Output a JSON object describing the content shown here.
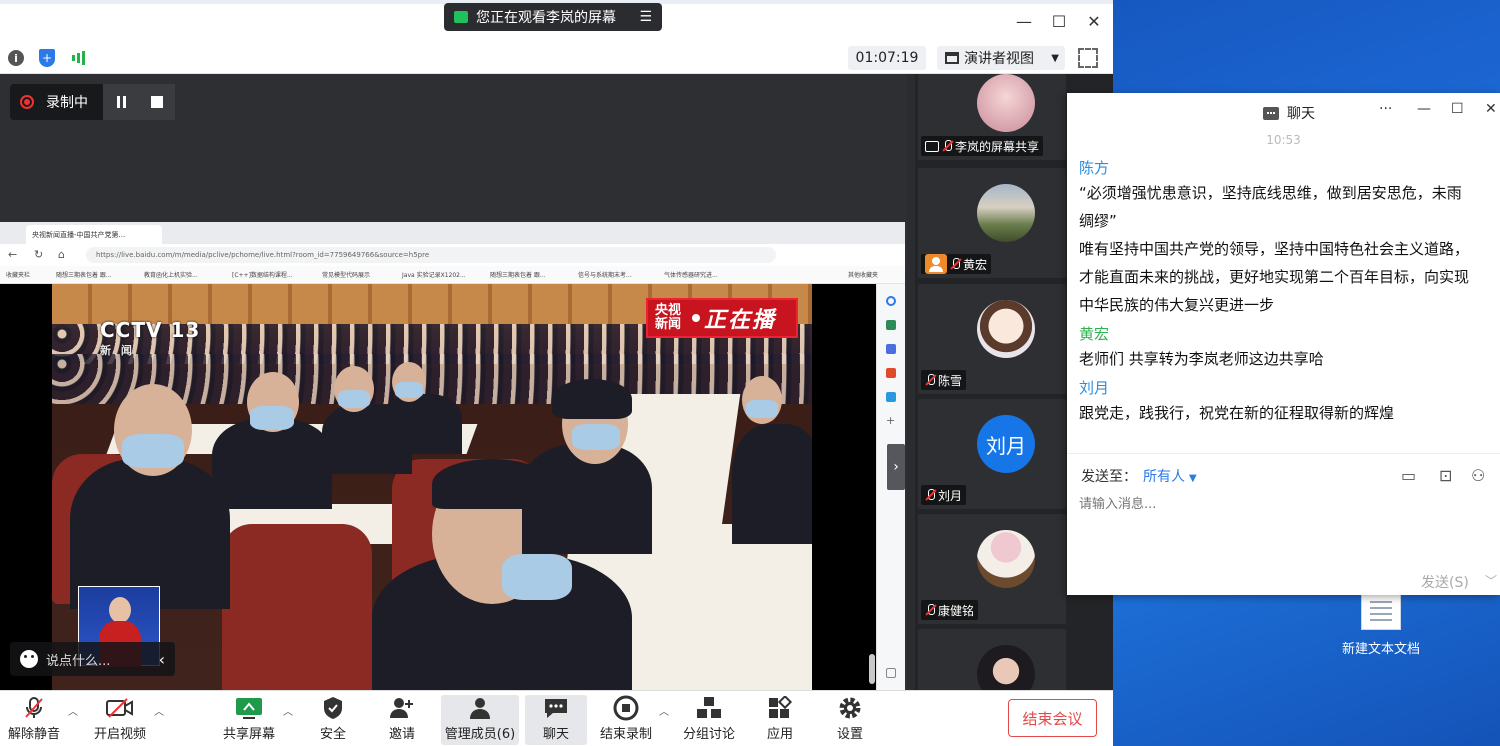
{
  "meeting": {
    "share_banner": "您正在观看李岚的屏幕",
    "timer": "01:07:19",
    "view_mode": "演讲者视图",
    "recording": {
      "label": "录制中"
    },
    "video_chat_placeholder": "说点什么..."
  },
  "browser": {
    "tab_title": "央视新闻直播-中国共产党第...",
    "url": "https://live.baidu.com/m/media/pclive/pchome/live.html?room_id=7759649766&source=h5pre",
    "favorites": [
      "收藏夹栏",
      "随想三期表包着 跟...",
      "教育函化上机实验...",
      "[C++]数据结构课程...",
      "常见模型代码展示",
      "Java 实验记录X1202...",
      "随想三期表包着 跟...",
      "信号与系统期末考...",
      "气体传感器研究进...",
      "其他收藏夹"
    ],
    "overlay": {
      "channel": "CCTV 13",
      "channel_sub": "新 闻",
      "live_left": "央视\n新闻",
      "live_right": "正在播"
    }
  },
  "participants": [
    {
      "name": "李岚的屏幕共享",
      "kind": "screen"
    },
    {
      "name": "黄宏",
      "kind": "user"
    },
    {
      "name": "陈雪",
      "kind": "user"
    },
    {
      "name": "刘月",
      "kind": "user",
      "avatar_text": "刘月"
    },
    {
      "name": "康健铭",
      "kind": "user"
    },
    {
      "name": "",
      "kind": "user"
    }
  ],
  "toolbar": {
    "mute": "解除静音",
    "video": "开启视频",
    "share": "共享屏幕",
    "security": "安全",
    "invite": "邀请",
    "members": "管理成员(6)",
    "chat": "聊天",
    "end_record": "结束录制",
    "breakout": "分组讨论",
    "apps": "应用",
    "settings": "设置",
    "end_meeting": "结束会议"
  },
  "chat": {
    "title": "聊天",
    "time": "10:53",
    "messages": [
      {
        "sender": "陈方",
        "lines": [
          "“必须增强忧患意识，坚持底线思维，做到居安思危，未雨",
          "绸缪”",
          "唯有坚持中国共产党的领导，坚持中国特色社会主义道路，",
          "才能直面未来的挑战，更好地实现第二个百年目标，向实现",
          "中华民族的伟大复兴更进一步"
        ]
      },
      {
        "sender": "黄宏",
        "lines": [
          "老师们 共享转为李岚老师这边共享哈"
        ]
      },
      {
        "sender": "刘月",
        "lines": [
          "跟党走，践我行，祝党在新的征程取得新的辉煌"
        ]
      }
    ],
    "send_to_label": "发送至：",
    "send_to_value": "所有人",
    "input_placeholder": "请输入消息...",
    "send_button": "发送(S)"
  },
  "desktop": {
    "file_label": "新建文本文档"
  },
  "colors": {
    "accent_blue": "#2a7ae8",
    "end_red": "#e24a4a",
    "chat_sender_blue": "#2a8de0",
    "chat_sender_green": "#2fb14f"
  }
}
